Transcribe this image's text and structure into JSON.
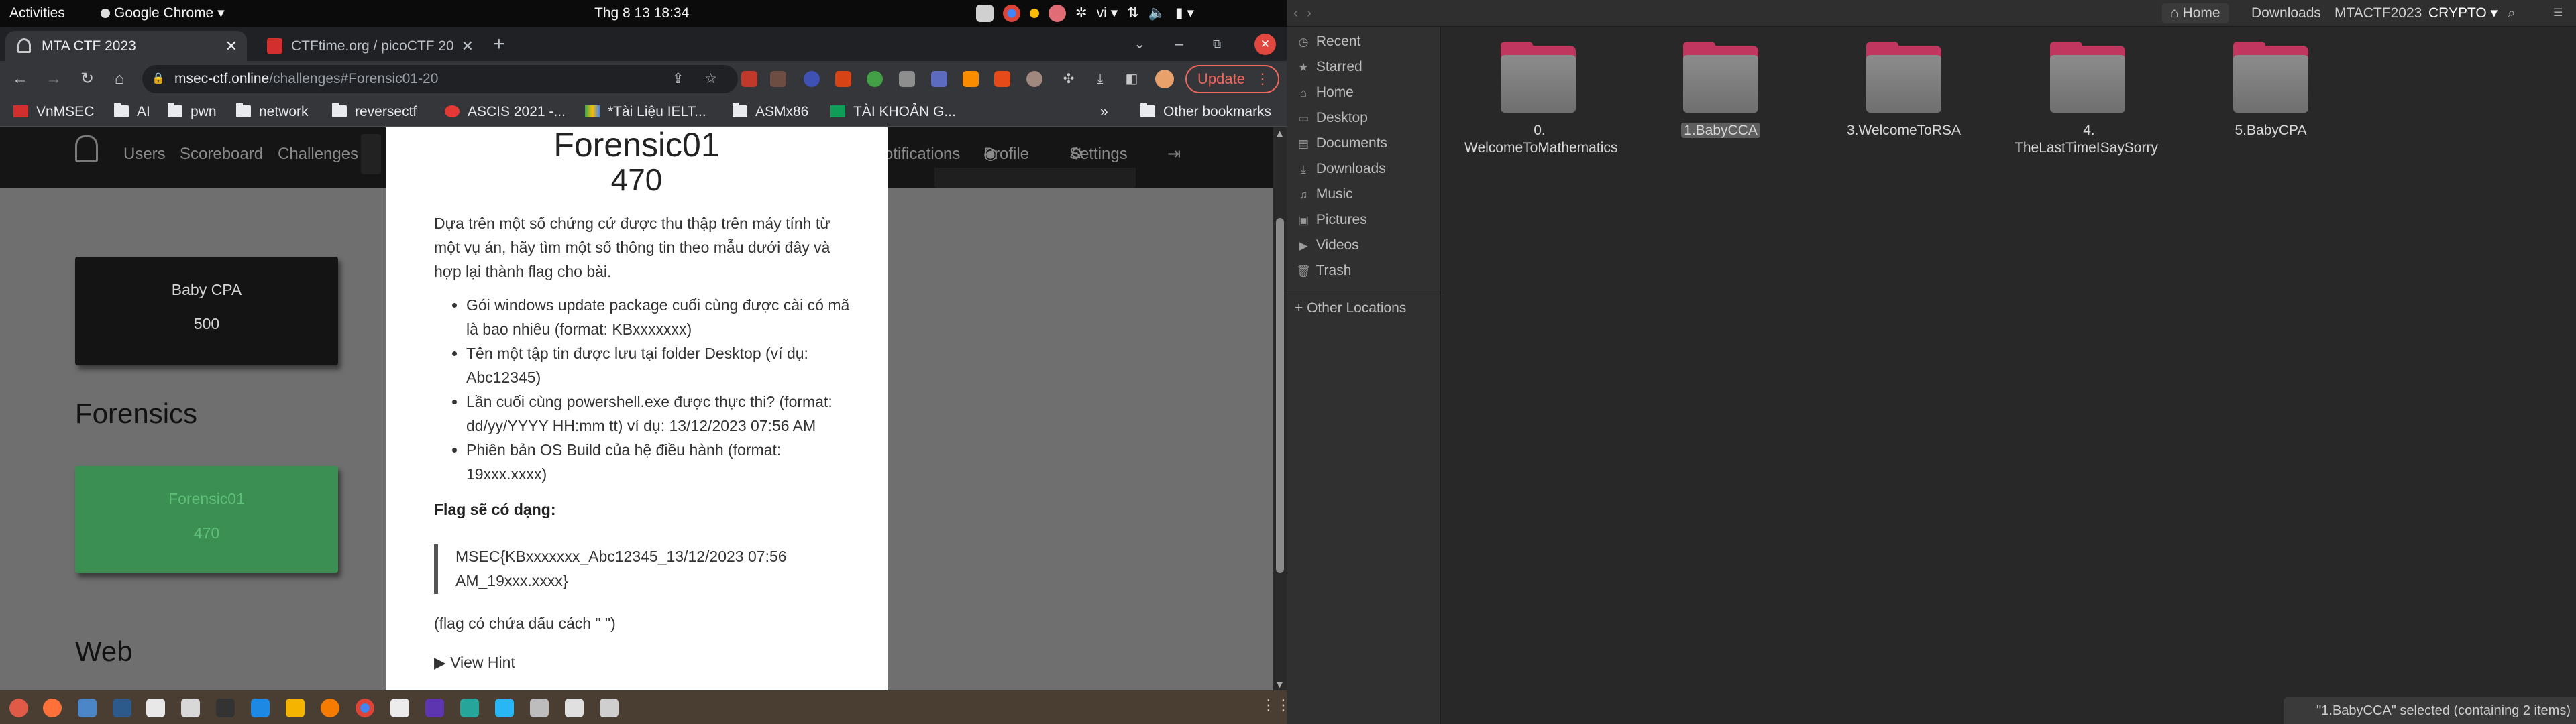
{
  "topbar": {
    "activities": "Activities",
    "app_menu": "Google Chrome",
    "clock": "Thg 8 13  18:34",
    "input_lang": "vi"
  },
  "chrome": {
    "tabs": [
      {
        "title": "MTA CTF 2023",
        "close": "✕",
        "active": true
      },
      {
        "title": "CTFtime.org / picoCTF 20",
        "close": "✕",
        "active": false
      }
    ],
    "new_tab": "+",
    "url_host": "msec-ctf.online",
    "url_path": "/challenges#Forensic01-20",
    "update_label": "Update",
    "bookmarks": [
      "VnMSEC",
      "AI",
      "pwn",
      "network",
      "reversectf",
      "ASCIS 2021 -...",
      "*Tài Liệu IELT...",
      "ASMx86",
      "TÀI KHOẢN G..."
    ],
    "more_bookmarks": "»",
    "other_bookmarks": "Other bookmarks"
  },
  "ctf": {
    "nav": [
      "Users",
      "Scoreboard",
      "Challenges"
    ],
    "nav_right": [
      "otifications",
      "Profile",
      "Settings"
    ],
    "cards": [
      {
        "name": "Baby CPA",
        "value": "500"
      },
      {
        "name": "Forensic01",
        "value": "470"
      }
    ],
    "sections": [
      "Forensics",
      "Web"
    ],
    "modal": {
      "title": "Forensic01",
      "value": "470",
      "description": "Dựa trên một số chứng cứ được thu thập trên máy tính từ một vụ án, hãy tìm một số thông tin theo mẫu dưới đây và hợp lại thành flag cho bài.",
      "items": [
        "Gói windows update package cuối cùng được cài có mã là bao nhiêu (format: KBxxxxxxx)",
        "Tên một tập tin được lưu tại folder Desktop (ví dụ: Abc12345)",
        "Lần cuối cùng powershell.exe được thực thi? (format: dd/yy/YYYY HH:mm tt) ví dụ: 13/12/2023 07:56 AM",
        "Phiên bản OS Build của hệ điều hành (format: 19xxx.xxxx)"
      ],
      "flag_label": "Flag sẽ có dạng:",
      "flag_format": "MSEC{KBxxxxxxx_Abc12345_13/12/2023 07:56 AM_19xxx.xxxx}",
      "flag_note": "(flag có chứa dấu cách \" \")",
      "hint_label": "▶ View Hint"
    }
  },
  "files": {
    "breadcrumbs": [
      "Home",
      "Downloads",
      "MTACTF2023",
      "CRYPTO"
    ],
    "sidebar": [
      {
        "label": "Recent",
        "icon": "clock-icon",
        "glyph": "◷"
      },
      {
        "label": "Starred",
        "icon": "star-icon",
        "glyph": "★"
      },
      {
        "label": "Home",
        "icon": "home-icon",
        "glyph": "⌂"
      },
      {
        "label": "Desktop",
        "icon": "desktop-icon",
        "glyph": "▭"
      },
      {
        "label": "Documents",
        "icon": "document-icon",
        "glyph": "▤"
      },
      {
        "label": "Downloads",
        "icon": "download-icon",
        "glyph": "⤓"
      },
      {
        "label": "Music",
        "icon": "music-icon",
        "glyph": "♫"
      },
      {
        "label": "Pictures",
        "icon": "picture-icon",
        "glyph": "▣"
      },
      {
        "label": "Videos",
        "icon": "video-icon",
        "glyph": "▶"
      },
      {
        "label": "Trash",
        "icon": "trash-icon",
        "glyph": "🗑"
      }
    ],
    "other_locations": "+ Other Locations",
    "folders": [
      {
        "name": "0. WelcomeToMathematics",
        "selected": false
      },
      {
        "name": "1.BabyCCA",
        "selected": true
      },
      {
        "name": "3.WelcomeToRSA",
        "selected": false
      },
      {
        "name": "4. TheLastTimeISaySorry",
        "selected": false
      },
      {
        "name": "5.BabyCPA",
        "selected": false
      }
    ],
    "status": "\"1.BabyCCA\" selected (containing 2 items)"
  },
  "colors": {
    "accent_red": "#ee675c",
    "folder_accent": "#c0365f",
    "solved_card": "#3b8f52",
    "ctf_nav_bg": "#151515"
  }
}
